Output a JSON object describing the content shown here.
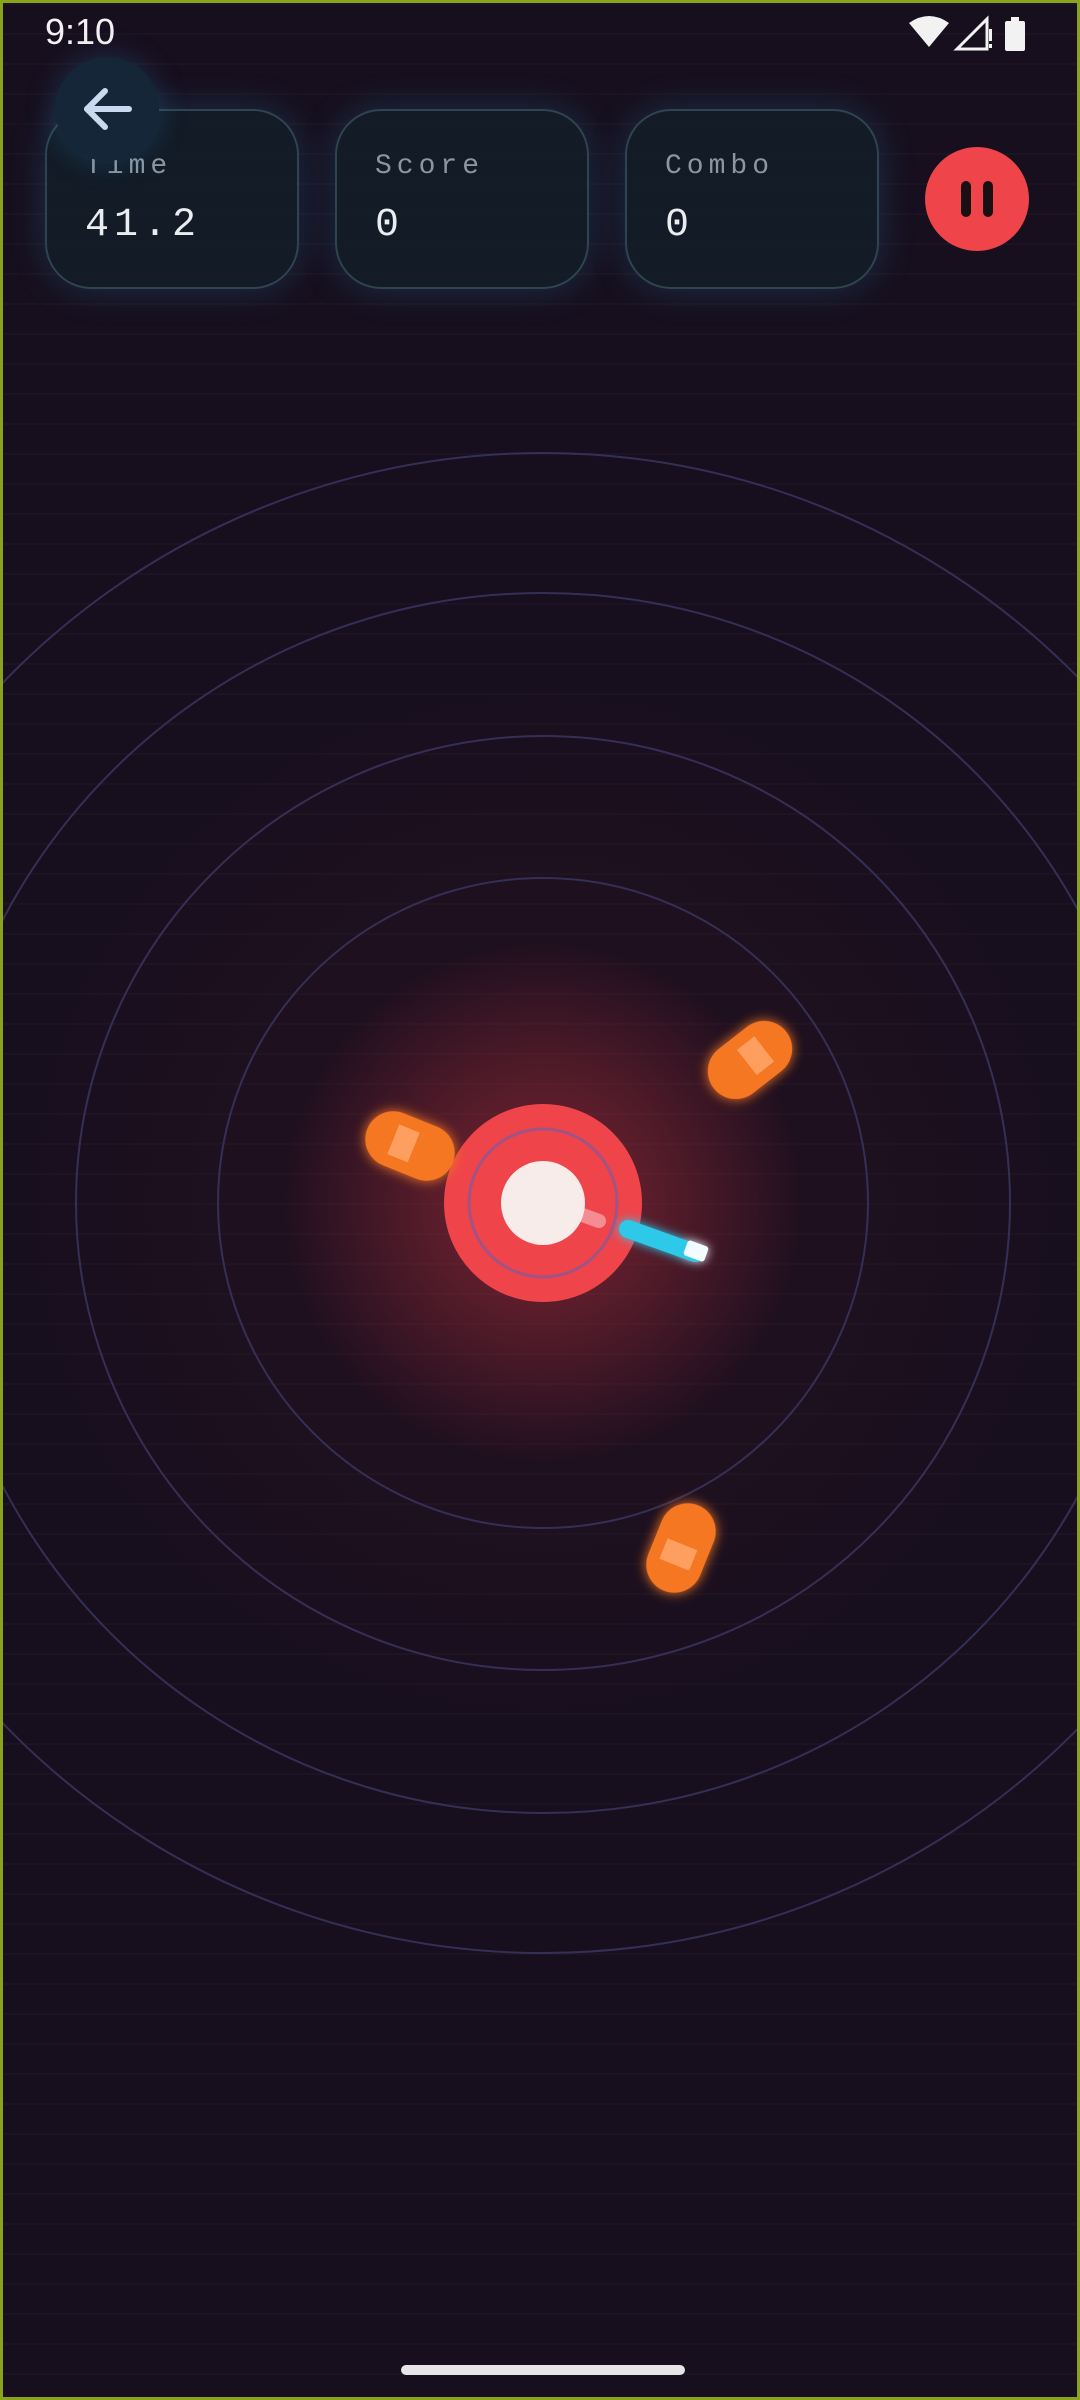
{
  "status_bar": {
    "time": "9:10",
    "icons": [
      "wifi-icon",
      "cellular-signal-icon",
      "battery-icon"
    ]
  },
  "hud": {
    "back_icon": "arrow-left-icon",
    "stats": [
      {
        "label": "Time",
        "value": "41.2"
      },
      {
        "label": "Score",
        "value": "0"
      },
      {
        "label": "Combo",
        "value": "0"
      }
    ],
    "pause_icon": "pause-icon"
  },
  "game": {
    "target_rings": 5,
    "orbiting_bullets": 3,
    "player_blade": "laser-blade"
  },
  "colors": {
    "background": "#170f1e",
    "hud_card_border": "#2f4450",
    "pause_button": "#ef444a",
    "target": "#ef444a",
    "target_core": "#f8ecea",
    "enemy": "#f57722",
    "blade": "#2ec8e8"
  }
}
